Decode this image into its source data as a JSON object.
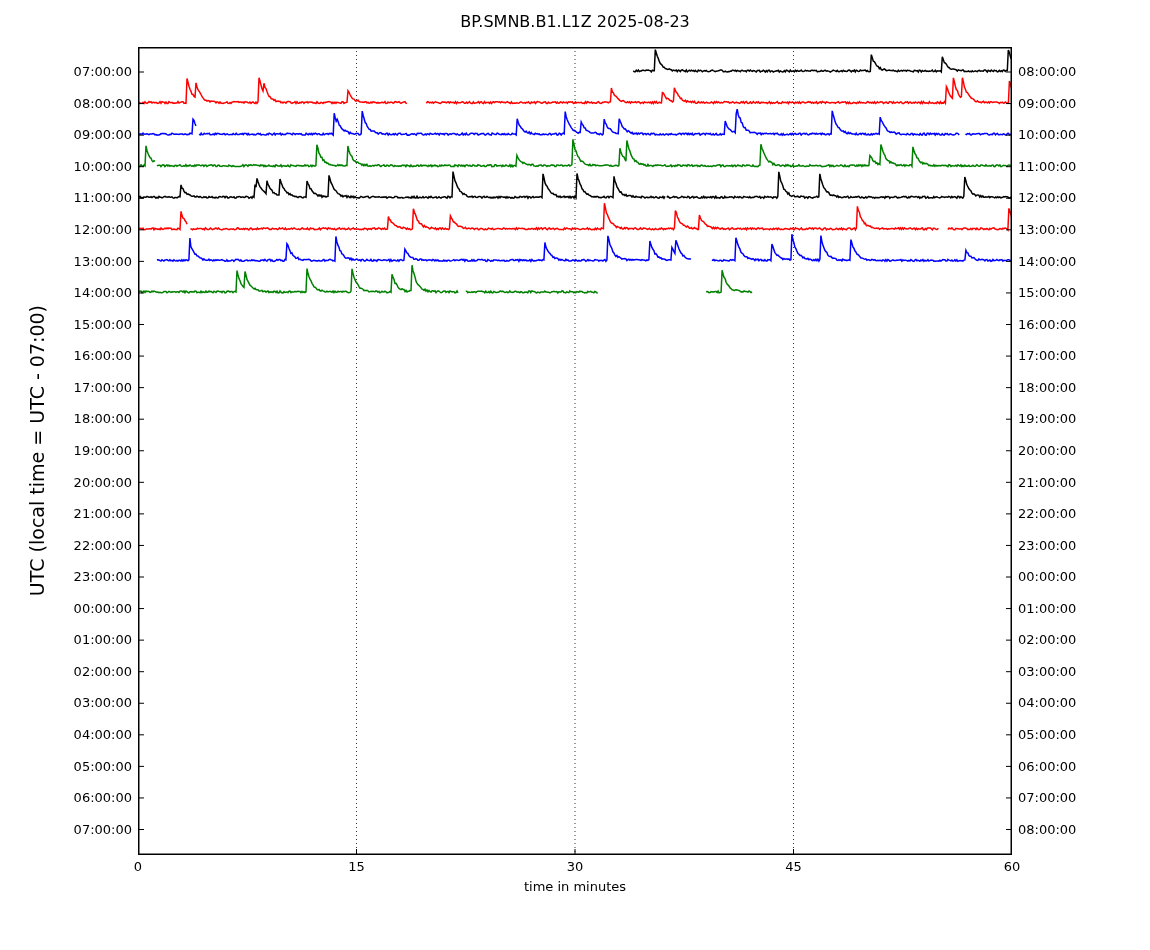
{
  "title": "BP.SMNB.B1.L1Z 2025-08-23",
  "ylabel": "UTC (local time = UTC - 07:00)",
  "xlabel": "time in minutes",
  "xticks": [
    "0",
    "15",
    "30",
    "45",
    "60"
  ],
  "left_labels": [
    "07:00:00",
    "08:00:00",
    "09:00:00",
    "10:00:00",
    "11:00:00",
    "12:00:00",
    "13:00:00",
    "14:00:00",
    "15:00:00",
    "16:00:00",
    "17:00:00",
    "18:00:00",
    "19:00:00",
    "20:00:00",
    "21:00:00",
    "22:00:00",
    "23:00:00",
    "00:00:00",
    "01:00:00",
    "02:00:00",
    "03:00:00",
    "04:00:00",
    "05:00:00",
    "06:00:00",
    "07:00:00"
  ],
  "right_labels": [
    "08:00:00",
    "09:00:00",
    "10:00:00",
    "11:00:00",
    "12:00:00",
    "13:00:00",
    "14:00:00",
    "15:00:00",
    "16:00:00",
    "17:00:00",
    "18:00:00",
    "19:00:00",
    "20:00:00",
    "21:00:00",
    "22:00:00",
    "23:00:00",
    "00:00:00",
    "01:00:00",
    "02:00:00",
    "03:00:00",
    "04:00:00",
    "05:00:00",
    "06:00:00",
    "07:00:00",
    "08:00:00"
  ],
  "traces": [
    {
      "color": "#000000"
    },
    {
      "color": "#ff0000"
    },
    {
      "color": "#0000ff"
    },
    {
      "color": "#008000"
    },
    {
      "color": "#000000"
    },
    {
      "color": "#ff0000"
    },
    {
      "color": "#0000ff"
    },
    {
      "color": "#008000"
    }
  ]
}
